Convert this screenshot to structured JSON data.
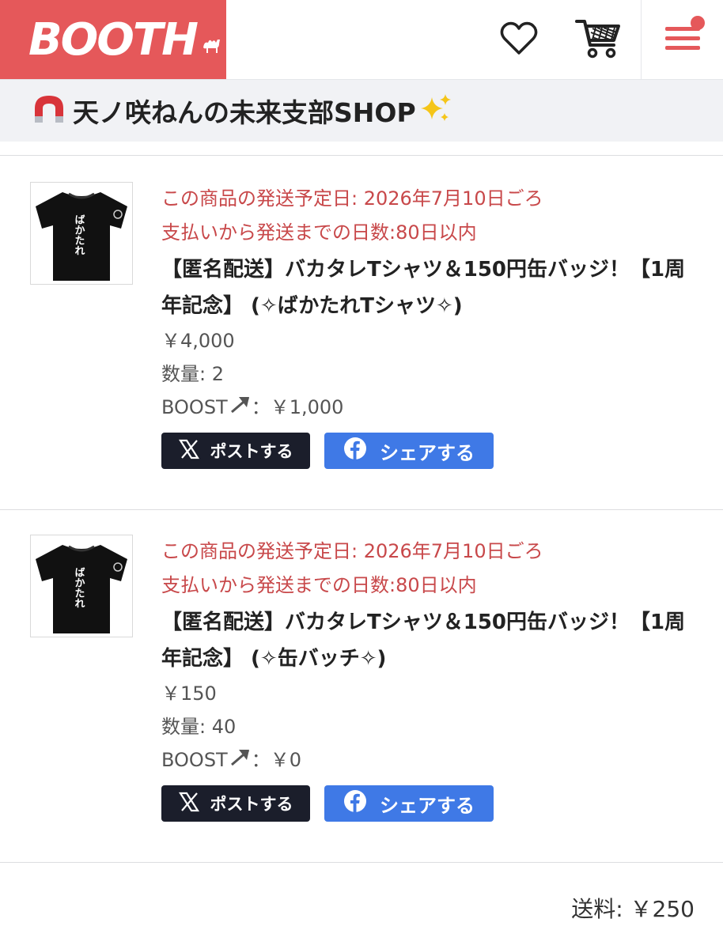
{
  "header": {
    "logo_text": "BOOTH",
    "brand_color": "#e5585a",
    "icons": [
      "heart-icon",
      "cart-icon",
      "menu-icon"
    ]
  },
  "shop": {
    "name": "天ノ咲ねんの未来支部SHOP"
  },
  "items": [
    {
      "ship_date": "この商品の発送予定日: 2026年7月10日ごろ",
      "ship_days": "支払いから発送までの日数:80日以内",
      "title": "【匿名配送】バカタレTシャツ＆150円缶バッジ！【1周年記念】 (✧ばかたれTシャツ✧)",
      "price": "￥4,000",
      "quantity": "数量: 2",
      "boost_label": "BOOST",
      "boost_value": "：￥1,000",
      "post_label": "ポストする",
      "share_label": "シェアする",
      "shirt_text": "ばかたれ"
    },
    {
      "ship_date": "この商品の発送予定日: 2026年7月10日ごろ",
      "ship_days": "支払いから発送までの日数:80日以内",
      "title": "【匿名配送】バカタレTシャツ＆150円缶バッジ！【1周年記念】 (✧缶バッチ✧)",
      "price": "￥150",
      "quantity": "数量: 40",
      "boost_label": "BOOST",
      "boost_value": "：￥0",
      "post_label": "ポストする",
      "share_label": "シェアする",
      "shirt_text": "ばかたれ"
    }
  ],
  "shipping": "送料: ￥250",
  "colors": {
    "accent": "#e5585a",
    "ship_text": "#c8484a",
    "x_button": "#1b1e2b",
    "facebook_button": "#3f79e6",
    "shop_bar": "#f1f2f5"
  }
}
